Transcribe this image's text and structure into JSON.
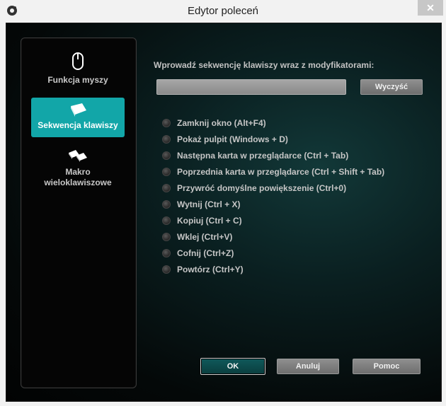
{
  "window": {
    "title": "Edytor poleceń",
    "close_glyph": "✕",
    "logo_icon": "logitech-logo-icon"
  },
  "sidebar": {
    "items": [
      {
        "label": "Funkcja myszy",
        "icon": "mouse-icon",
        "active": false
      },
      {
        "label": "Sekwencja klawiszy",
        "icon": "key-icon",
        "active": true
      },
      {
        "label_line1": "Makro",
        "label_line2": "wieloklawiszowe",
        "icon": "multi-key-icon",
        "active": false
      }
    ]
  },
  "main": {
    "prompt": "Wprowadź sekwencję klawiszy wraz z modyfikatorami:",
    "sequence_value": "",
    "clear_label": "Wyczyść",
    "options": [
      "Zamknij okno (Alt+F4)",
      "Pokaż pulpit (Windows + D)",
      "Następna karta w przeglądarce (Ctrl + Tab)",
      "Poprzednia karta w przeglądarce (Ctrl + Shift + Tab)",
      "Przywróć domyślne powiększenie (Ctrl+0)",
      "Wytnij (Ctrl + X)",
      "Kopiuj (Ctrl + C)",
      "Wklej (Ctrl+V)",
      "Cofnij (Ctrl+Z)",
      "Powtórz (Ctrl+Y)"
    ]
  },
  "footer": {
    "ok_label": "OK",
    "cancel_label": "Anuluj",
    "help_label": "Pomoc"
  },
  "colors": {
    "accent": "#12a6a8",
    "background_dark": "#040808"
  }
}
